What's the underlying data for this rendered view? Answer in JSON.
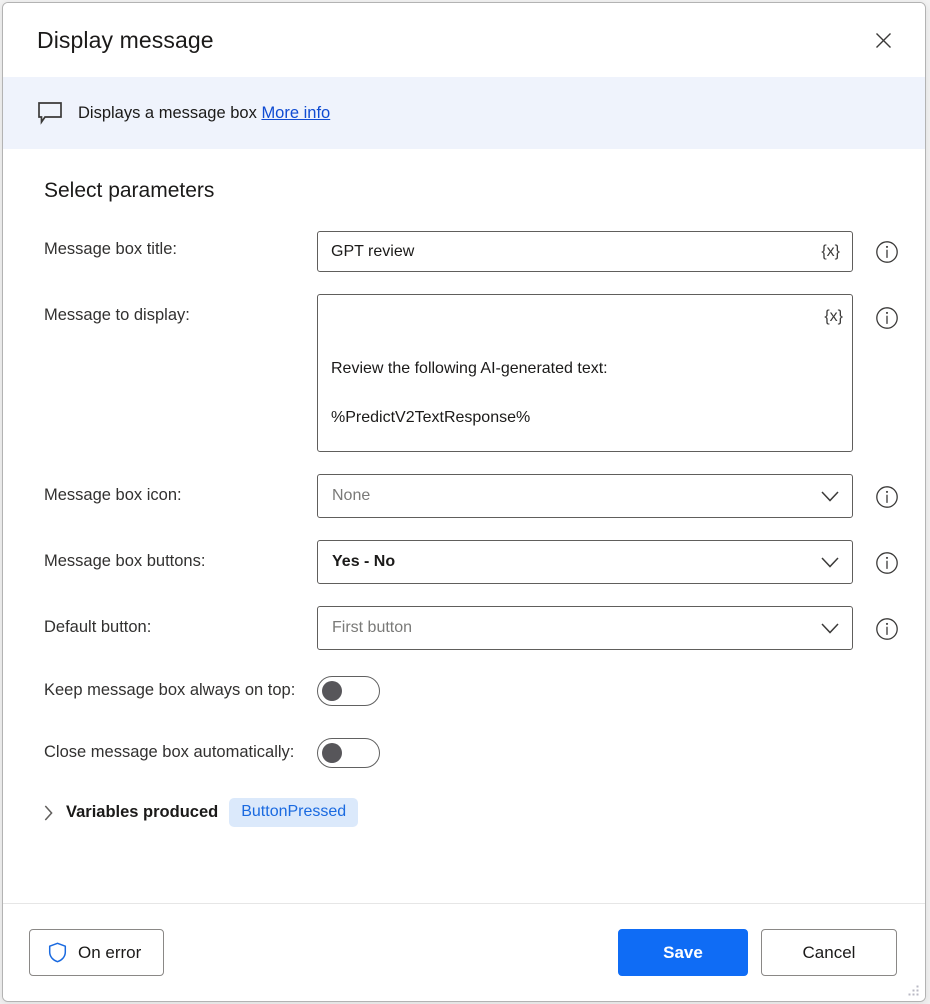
{
  "dialog": {
    "title": "Display message",
    "close_icon": "close-icon"
  },
  "banner": {
    "icon": "message-bubble-icon",
    "description": "Displays a message box",
    "more_info_link": "More info"
  },
  "main": {
    "section_title": "Select parameters",
    "fields": [
      {
        "label": "Message box title:",
        "type": "text",
        "value": "GPT review",
        "variable_button": "{x}",
        "info_icon": "info-icon"
      },
      {
        "label": "Message to display:",
        "type": "textarea",
        "value": "Review the following AI-generated text:\n\n%PredictV2TextResponse%",
        "variable_button": "{x}",
        "info_icon": "info-icon"
      },
      {
        "label": "Message box icon:",
        "type": "select",
        "value": "None",
        "is_default": true,
        "info_icon": "info-icon"
      },
      {
        "label": "Message box buttons:",
        "type": "select",
        "value": "Yes - No",
        "is_default": false,
        "info_icon": "info-icon"
      },
      {
        "label": "Default button:",
        "type": "select",
        "value": "First button",
        "is_default": true,
        "info_icon": "info-icon"
      },
      {
        "label": "Keep message box always on top:",
        "type": "toggle",
        "value": "off",
        "info_icon": "info-icon"
      },
      {
        "label": "Close message box automatically:",
        "type": "toggle",
        "value": "off",
        "info_icon": "info-icon"
      }
    ],
    "variables_produced": {
      "label": "Variables produced",
      "chevron_icon": "chevron-right-icon",
      "expanded": false,
      "variables": [
        "ButtonPressed"
      ]
    }
  },
  "footer": {
    "on_error_label": "On error",
    "on_error_icon": "shield-icon",
    "save_label": "Save",
    "cancel_label": "Cancel",
    "resize_grip": "resize-grip-icon"
  },
  "colors": {
    "accent": "#0f6cf5",
    "link": "#0f4bd2",
    "banner_bg": "#eff3fc",
    "variable_pill_bg": "#dbe9fb",
    "variable_pill_text": "#1a6ae0"
  }
}
